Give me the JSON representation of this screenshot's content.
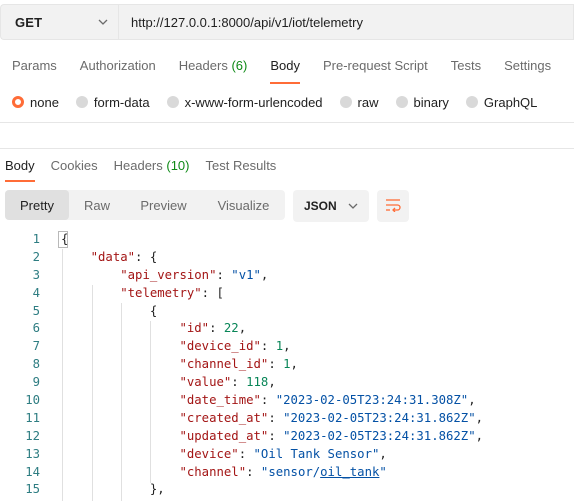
{
  "request": {
    "method": "GET",
    "url": "http://127.0.0.1:8000/api/v1/iot/telemetry"
  },
  "request_tabs": [
    {
      "label": "Params"
    },
    {
      "label": "Authorization"
    },
    {
      "label": "Headers",
      "count": "(6)"
    },
    {
      "label": "Body"
    },
    {
      "label": "Pre-request Script"
    },
    {
      "label": "Tests"
    },
    {
      "label": "Settings"
    }
  ],
  "body_types": [
    "none",
    "form-data",
    "x-www-form-urlencoded",
    "raw",
    "binary",
    "GraphQL"
  ],
  "body_type_selected": "none",
  "response_tabs": [
    {
      "label": "Body"
    },
    {
      "label": "Cookies"
    },
    {
      "label": "Headers",
      "count": "(10)"
    },
    {
      "label": "Test Results"
    }
  ],
  "view_modes": [
    "Pretty",
    "Raw",
    "Preview",
    "Visualize"
  ],
  "view_mode_selected": "Pretty",
  "format": "JSON",
  "icons": {
    "method_chevron": "chevron-down-icon",
    "format_chevron": "chevron-down-icon",
    "wrap": "wrap-lines-icon"
  },
  "colors": {
    "accent": "#ff6c37",
    "count_green": "#0e8a16",
    "json_key": "#a31515",
    "json_string": "#0451a5",
    "json_number": "#098658",
    "line_number": "#2e7d82"
  },
  "code_lines": [
    {
      "n": "1",
      "tokens": [
        {
          "t": "p",
          "v": "{"
        }
      ]
    },
    {
      "n": "2",
      "tokens": [
        {
          "t": "p",
          "v": "    "
        },
        {
          "t": "k",
          "v": "\"data\""
        },
        {
          "t": "p",
          "v": ": {"
        }
      ]
    },
    {
      "n": "3",
      "tokens": [
        {
          "t": "p",
          "v": "        "
        },
        {
          "t": "k",
          "v": "\"api_version\""
        },
        {
          "t": "p",
          "v": ": "
        },
        {
          "t": "s",
          "v": "\"v1\""
        },
        {
          "t": "p",
          "v": ","
        }
      ]
    },
    {
      "n": "4",
      "tokens": [
        {
          "t": "p",
          "v": "        "
        },
        {
          "t": "k",
          "v": "\"telemetry\""
        },
        {
          "t": "p",
          "v": ": ["
        }
      ]
    },
    {
      "n": "5",
      "tokens": [
        {
          "t": "p",
          "v": "            {"
        }
      ]
    },
    {
      "n": "6",
      "tokens": [
        {
          "t": "p",
          "v": "                "
        },
        {
          "t": "k",
          "v": "\"id\""
        },
        {
          "t": "p",
          "v": ": "
        },
        {
          "t": "n",
          "v": "22"
        },
        {
          "t": "p",
          "v": ","
        }
      ]
    },
    {
      "n": "7",
      "tokens": [
        {
          "t": "p",
          "v": "                "
        },
        {
          "t": "k",
          "v": "\"device_id\""
        },
        {
          "t": "p",
          "v": ": "
        },
        {
          "t": "n",
          "v": "1"
        },
        {
          "t": "p",
          "v": ","
        }
      ]
    },
    {
      "n": "8",
      "tokens": [
        {
          "t": "p",
          "v": "                "
        },
        {
          "t": "k",
          "v": "\"channel_id\""
        },
        {
          "t": "p",
          "v": ": "
        },
        {
          "t": "n",
          "v": "1"
        },
        {
          "t": "p",
          "v": ","
        }
      ]
    },
    {
      "n": "9",
      "tokens": [
        {
          "t": "p",
          "v": "                "
        },
        {
          "t": "k",
          "v": "\"value\""
        },
        {
          "t": "p",
          "v": ": "
        },
        {
          "t": "n",
          "v": "118"
        },
        {
          "t": "p",
          "v": ","
        }
      ]
    },
    {
      "n": "10",
      "tokens": [
        {
          "t": "p",
          "v": "                "
        },
        {
          "t": "k",
          "v": "\"date_time\""
        },
        {
          "t": "p",
          "v": ": "
        },
        {
          "t": "s",
          "v": "\"2023-02-05T23:24:31.308Z\""
        },
        {
          "t": "p",
          "v": ","
        }
      ]
    },
    {
      "n": "11",
      "tokens": [
        {
          "t": "p",
          "v": "                "
        },
        {
          "t": "k",
          "v": "\"created_at\""
        },
        {
          "t": "p",
          "v": ": "
        },
        {
          "t": "s",
          "v": "\"2023-02-05T23:24:31.862Z\""
        },
        {
          "t": "p",
          "v": ","
        }
      ]
    },
    {
      "n": "12",
      "tokens": [
        {
          "t": "p",
          "v": "                "
        },
        {
          "t": "k",
          "v": "\"updated_at\""
        },
        {
          "t": "p",
          "v": ": "
        },
        {
          "t": "s",
          "v": "\"2023-02-05T23:24:31.862Z\""
        },
        {
          "t": "p",
          "v": ","
        }
      ]
    },
    {
      "n": "13",
      "tokens": [
        {
          "t": "p",
          "v": "                "
        },
        {
          "t": "k",
          "v": "\"device\""
        },
        {
          "t": "p",
          "v": ": "
        },
        {
          "t": "s",
          "v": "\"Oil Tank Sensor\""
        },
        {
          "t": "p",
          "v": ","
        }
      ]
    },
    {
      "n": "14",
      "tokens": [
        {
          "t": "p",
          "v": "                "
        },
        {
          "t": "k",
          "v": "\"channel\""
        },
        {
          "t": "p",
          "v": ": "
        },
        {
          "t": "s",
          "v": "\"sensor/"
        },
        {
          "t": "su",
          "v": "oil_tank"
        },
        {
          "t": "s",
          "v": "\""
        }
      ]
    },
    {
      "n": "15",
      "tokens": [
        {
          "t": "p",
          "v": "            },"
        }
      ]
    }
  ]
}
